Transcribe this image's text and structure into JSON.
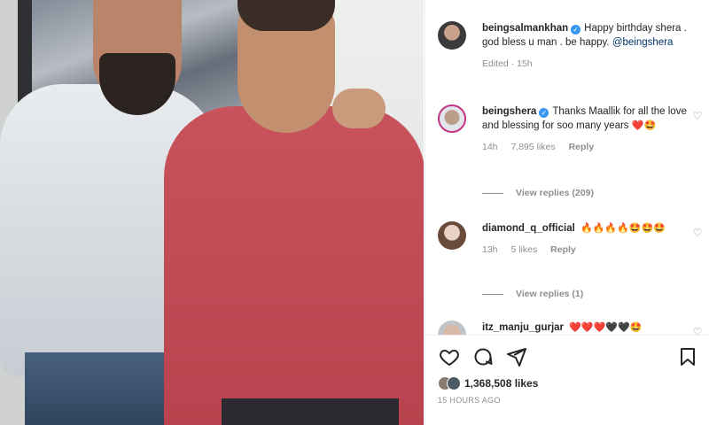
{
  "comments": [
    {
      "username": "beingsalmankhan",
      "text": "Happy birthday shera . god bless u man . be happy.",
      "mention": "@beingshera",
      "meta": {
        "edited": "Edited · 15h"
      }
    },
    {
      "username": "beingshera",
      "text": "Thanks Maallik for all the love and blessing for soo many years",
      "emoji": "❤️🤩",
      "meta": {
        "time": "14h",
        "likes": "7,895 likes",
        "reply": "Reply"
      },
      "view_replies": "View replies (209)"
    },
    {
      "username": "diamond_q_official",
      "emoji": "🔥🔥🔥🔥🤩🤩🤩",
      "meta": {
        "time": "13h",
        "likes": "5 likes",
        "reply": "Reply"
      },
      "view_replies": "View replies (1)"
    },
    {
      "username": "itz_manju_gurjar",
      "emoji": "❤️❤️❤️🖤🖤🤩"
    }
  ],
  "post": {
    "likes_text": "1,368,508 likes",
    "time_ago": "15 HOURS AGO"
  },
  "icons": {
    "like": "heart-icon",
    "comment": "comment-icon",
    "share": "share-icon",
    "save": "bookmark-icon",
    "comment_like": "heart-outline-icon"
  },
  "colors": {
    "verified": "#3897f0",
    "mention": "#00376b",
    "muted": "#8e8e8e",
    "text": "#262626"
  }
}
